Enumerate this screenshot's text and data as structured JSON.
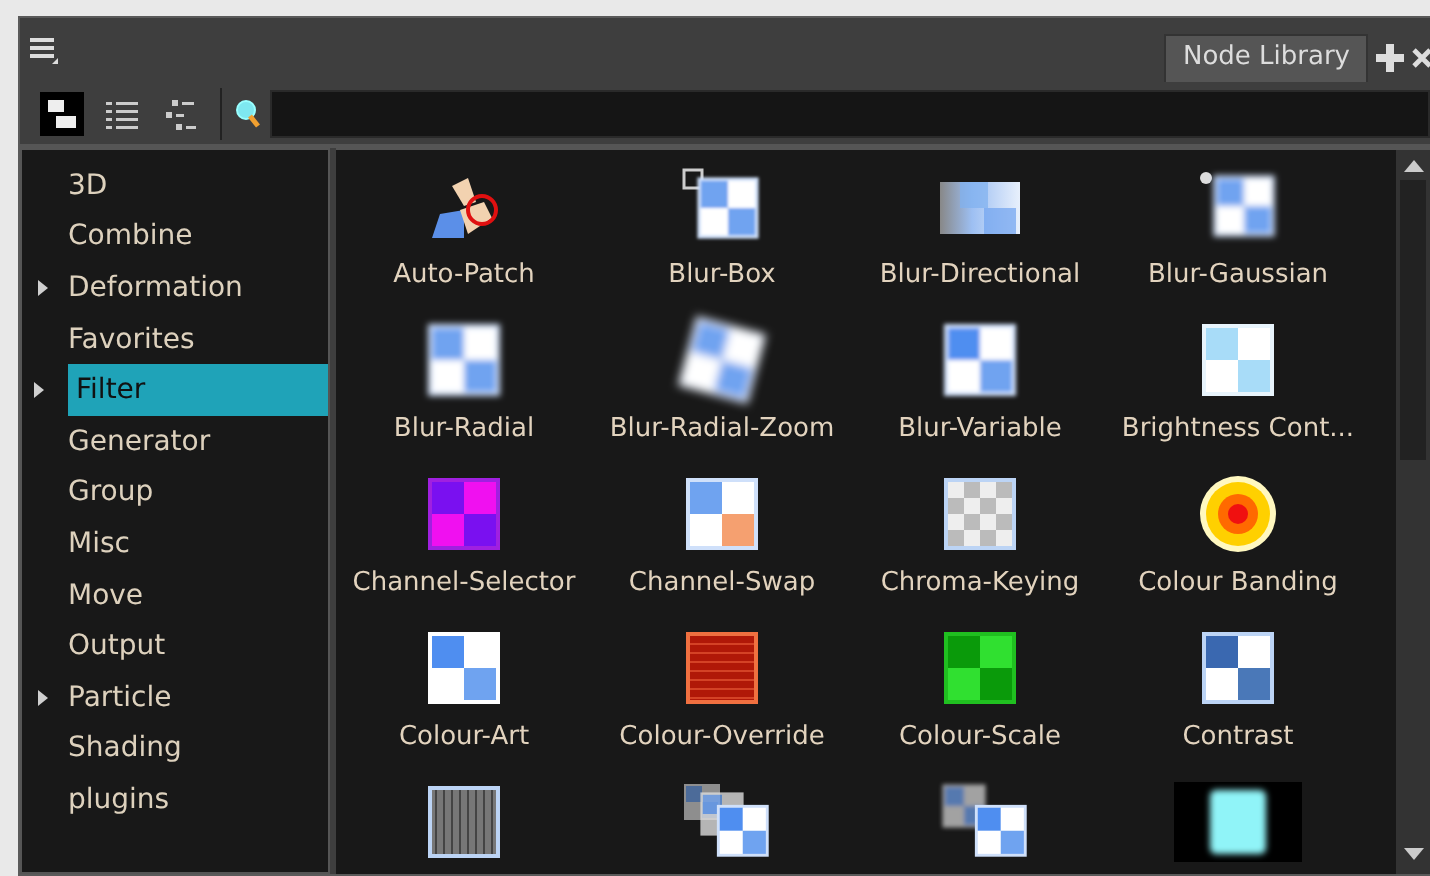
{
  "panel": {
    "tab": {
      "label": "Node Library",
      "selected": true
    }
  },
  "view_buttons": [
    {
      "kind": "tree-grid",
      "selected": true
    },
    {
      "kind": "list",
      "selected": false
    },
    {
      "kind": "tree",
      "selected": false
    }
  ],
  "categories": [
    {
      "label": "3D",
      "expandable": false,
      "selected": false
    },
    {
      "label": "Combine",
      "expandable": false,
      "selected": false
    },
    {
      "label": "Deformation",
      "expandable": true,
      "selected": false
    },
    {
      "label": "Favorites",
      "expandable": false,
      "selected": false
    },
    {
      "label": "Filter",
      "expandable": true,
      "selected": true
    },
    {
      "label": "Generator",
      "expandable": false,
      "selected": false
    },
    {
      "label": "Group",
      "expandable": false,
      "selected": false
    },
    {
      "label": "Misc",
      "expandable": false,
      "selected": false
    },
    {
      "label": "Move",
      "expandable": false,
      "selected": false
    },
    {
      "label": "Output",
      "expandable": false,
      "selected": false
    },
    {
      "label": "Particle",
      "expandable": true,
      "selected": false
    },
    {
      "label": "Shading",
      "expandable": false,
      "selected": false
    },
    {
      "label": "plugins",
      "expandable": false,
      "selected": false
    }
  ],
  "nodes": [
    {
      "label": "Auto-Patch",
      "kind": "patch"
    },
    {
      "label": "Blur-Box",
      "kind": "blur-box"
    },
    {
      "label": "Blur-Directional",
      "kind": "blur-directional"
    },
    {
      "label": "Blur-Gaussian",
      "kind": "blur-gaussian"
    },
    {
      "label": "Blur-Radial",
      "kind": "blur-radial"
    },
    {
      "label": "Blur-Radial-Zoom",
      "kind": "blur-zoom"
    },
    {
      "label": "Blur-Variable",
      "kind": "blur-variable"
    },
    {
      "label": "Brightness Cont...",
      "kind": "brightness"
    },
    {
      "label": "Channel-Selector",
      "kind": "channel-selector"
    },
    {
      "label": "Channel-Swap",
      "kind": "channel-swap"
    },
    {
      "label": "Chroma-Keying",
      "kind": "chroma"
    },
    {
      "label": "Colour Banding",
      "kind": "banding"
    },
    {
      "label": "Colour-Art",
      "kind": "colour-art"
    },
    {
      "label": "Colour-Override",
      "kind": "brick"
    },
    {
      "label": "Colour-Scale",
      "kind": "colour-scale"
    },
    {
      "label": "Contrast",
      "kind": "contrast"
    },
    {
      "kind": "noise"
    },
    {
      "kind": "stack"
    },
    {
      "kind": "stack-blur"
    },
    {
      "kind": "glow"
    }
  ]
}
